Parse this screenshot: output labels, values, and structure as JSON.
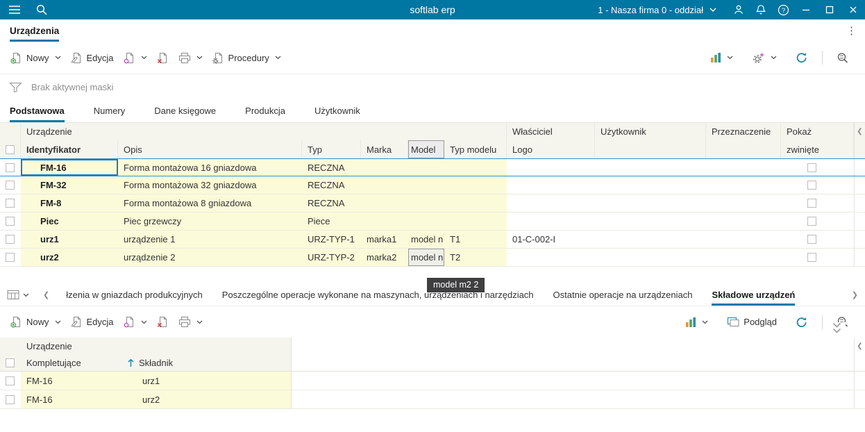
{
  "colors": {
    "topbar": "#0076a3",
    "accent_underline": "#0079a9",
    "row_highlight": "#fbfbd9",
    "selection_border": "#1e7bbf",
    "tooltip_bg": "#3f3f41"
  },
  "icons": {
    "kebab": "⋮",
    "chevron_left": "❮",
    "chevron_right": "❯"
  },
  "titlebar": {
    "title": "softlab erp",
    "company_selector": "1 - Nasza firma 0 - oddział"
  },
  "module_tab": "Urządzenia",
  "toolbar": {
    "nowy": "Nowy",
    "edycja": "Edycja",
    "procedury": "Procedury",
    "podglad": "Podgląd"
  },
  "filter": "Brak aktywnej maski",
  "subtabs": [
    "Podstawowa",
    "Numery",
    "Dane księgowe",
    "Produkcja",
    "Użytkownik"
  ],
  "main_table": {
    "groups": {
      "urzadzenie": "Urządzenie",
      "wlasciciel": "Właściciel",
      "uzytkownik": "Użytkownik",
      "przeznaczenie": "Przeznaczenie",
      "pokaz": "Pokaż"
    },
    "headers": {
      "identyfikator": "Identyfikator",
      "opis": "Opis",
      "typ": "Typ",
      "marka": "Marka",
      "model": "Model",
      "typ_modelu": "Typ modelu",
      "logo": "Logo",
      "zwiniete": "zwinięte"
    },
    "rows": [
      {
        "id": "FM-16",
        "opis": "Forma montażowa 16 gniazdowa",
        "typ": "RECZNA"
      },
      {
        "id": "FM-32",
        "opis": "Forma montażowa 32 gniazdowa",
        "typ": "RECZNA"
      },
      {
        "id": "FM-8",
        "opis": "Forma montażowa 8 gniazdowa",
        "typ": "RECZNA"
      },
      {
        "id": "Piec",
        "opis": "Piec grzewczy",
        "typ": "Piece"
      },
      {
        "id": "urz1",
        "opis": "urządzenie 1",
        "typ": "URZ-TYP-1",
        "marka": "marka1",
        "model": "model n",
        "typ_modelu": "T1",
        "logo": "01-C-002-I"
      },
      {
        "id": "urz2",
        "opis": "urządzenie 2",
        "typ": "URZ-TYP-2",
        "marka": "marka2",
        "model": "model n",
        "typ_modelu": "T2"
      }
    ]
  },
  "tooltip": "model m2 2",
  "detail_tabs": [
    "łzenia w gniazdach produkcyjnych",
    "Poszczególne operacje wykonane na maszynach, urządzeniach i narzędziach",
    "Ostatnie operacje na urządzeniach",
    "Składowe urządzeń"
  ],
  "detail_table": {
    "group": "Urządzenie",
    "headers": {
      "kompletujace": "Kompletujące",
      "skladnik": "Składnik"
    },
    "rows": [
      {
        "kompletujace": "FM-16",
        "skladnik": "urz1"
      },
      {
        "kompletujace": "FM-16",
        "skladnik": "urz2"
      }
    ]
  }
}
